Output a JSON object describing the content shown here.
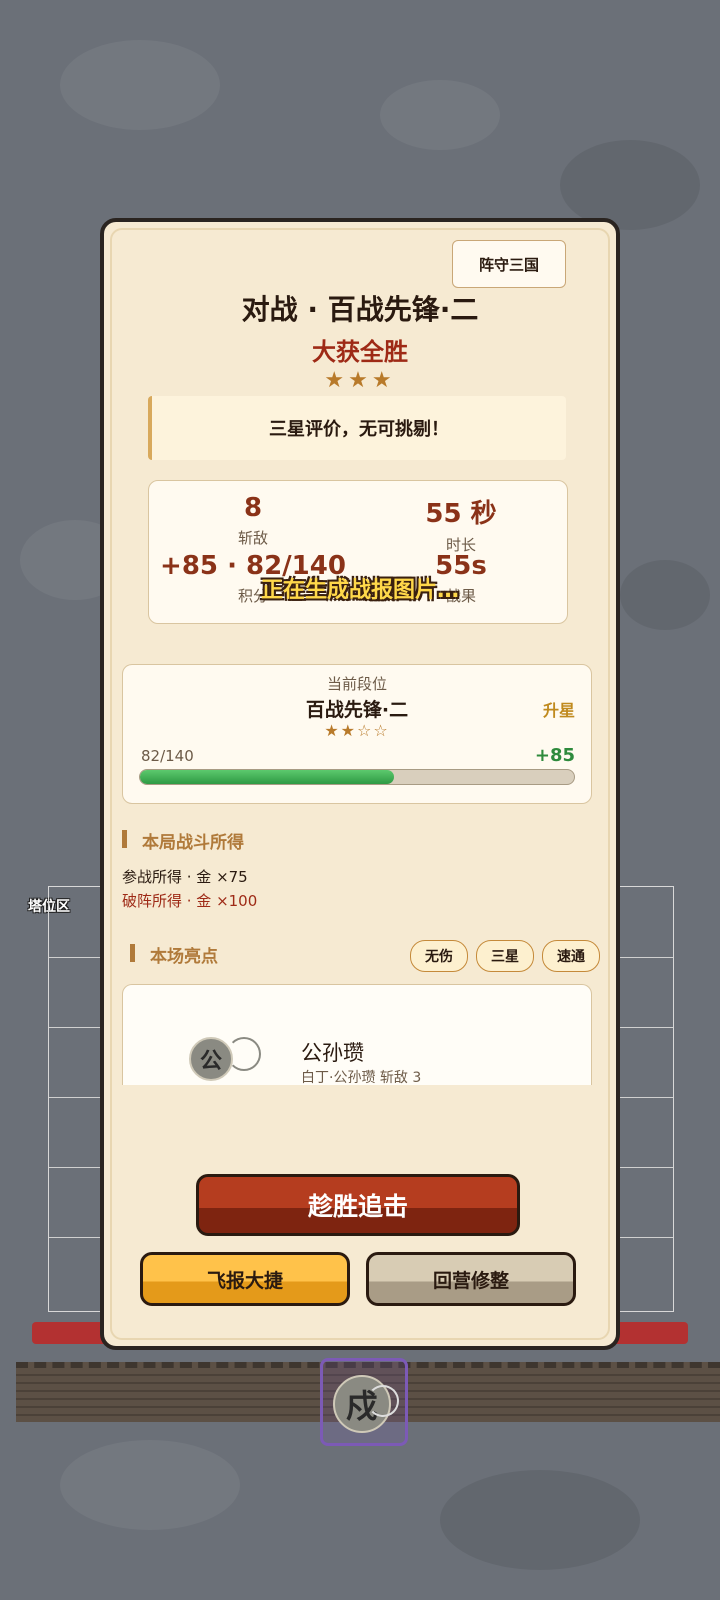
{
  "background": {
    "board_label": "塔位区",
    "unit_glyph": "戍"
  },
  "panel": {
    "game_name": "阵守三国",
    "battle_title": "对战 · 百战先锋·二",
    "result": "大获全胜",
    "stars": "★★★",
    "comment": "三星评价，无可挑剔！",
    "stats": [
      {
        "value": "8",
        "label": "斩敌"
      },
      {
        "value": "55 秒",
        "label": "时长"
      },
      {
        "value": "+85 · 82/140",
        "label": "积分"
      },
      {
        "value": "55s",
        "label": "战果"
      }
    ],
    "overlay": "正在生成战报图片…",
    "rank": {
      "caption": "当前段位",
      "name": "百战先锋·二",
      "stars": "★★☆☆",
      "upgrade": "升星",
      "progress_text": "82/140",
      "progress_current": 82,
      "progress_max": 140,
      "gain": "+85"
    },
    "rewards_title": "本局战斗所得",
    "rewards": [
      {
        "text": "参战所得 · 金 ×75",
        "style": "normal"
      },
      {
        "text": "破阵所得 · 金 ×100",
        "style": "red"
      }
    ],
    "highlights_title": "本场亮点",
    "highlight_tags": [
      "无伤",
      "三星",
      "速通"
    ],
    "hero": {
      "glyph": "公",
      "name": "公孙瓒",
      "sub": "白丁·公孙瓒 斩敌 3"
    },
    "buttons": {
      "main": "趁胜追击",
      "share": "飞报大捷",
      "back": "回营修整"
    }
  }
}
